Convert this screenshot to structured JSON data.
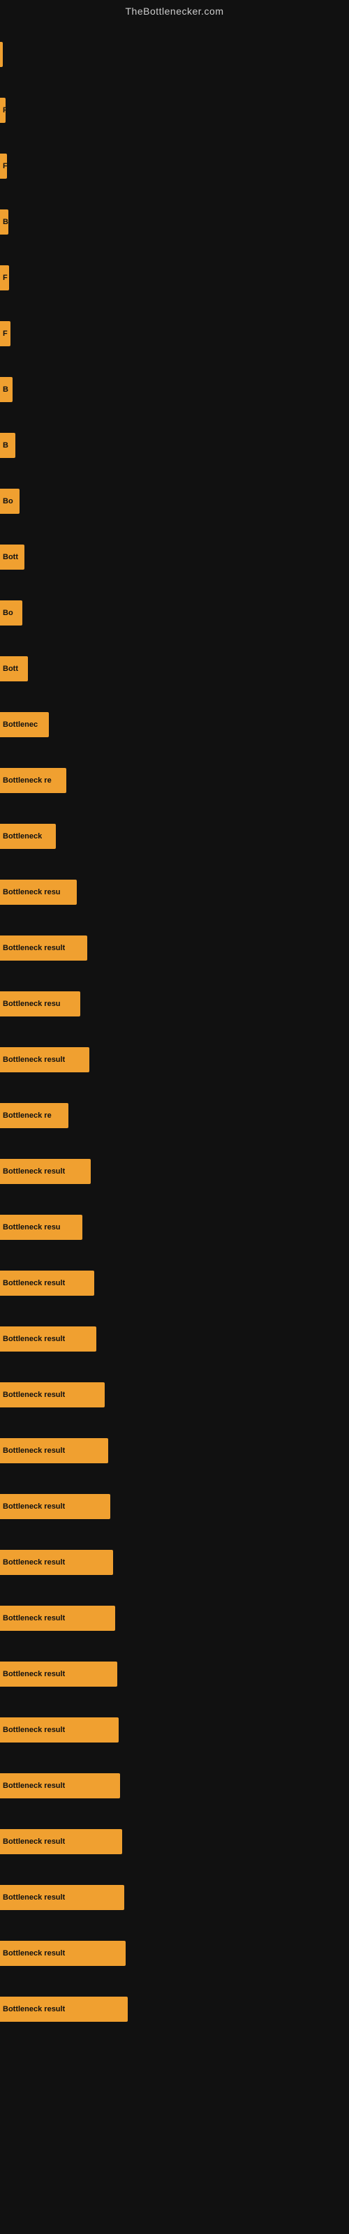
{
  "site_title": "TheBottlenecker.com",
  "bars": [
    {
      "label": "|",
      "width": 4
    },
    {
      "label": "F",
      "width": 8
    },
    {
      "label": "F",
      "width": 10
    },
    {
      "label": "B",
      "width": 12
    },
    {
      "label": "F",
      "width": 13
    },
    {
      "label": "F",
      "width": 15
    },
    {
      "label": "B",
      "width": 18
    },
    {
      "label": "B",
      "width": 22
    },
    {
      "label": "Bo",
      "width": 28
    },
    {
      "label": "Bott",
      "width": 35
    },
    {
      "label": "Bo",
      "width": 32
    },
    {
      "label": "Bott",
      "width": 40
    },
    {
      "label": "Bottlenec",
      "width": 70
    },
    {
      "label": "Bottleneck re",
      "width": 95
    },
    {
      "label": "Bottleneck",
      "width": 80
    },
    {
      "label": "Bottleneck resu",
      "width": 110
    },
    {
      "label": "Bottleneck result",
      "width": 125
    },
    {
      "label": "Bottleneck resu",
      "width": 115
    },
    {
      "label": "Bottleneck result",
      "width": 128
    },
    {
      "label": "Bottleneck re",
      "width": 98
    },
    {
      "label": "Bottleneck result",
      "width": 130
    },
    {
      "label": "Bottleneck resu",
      "width": 118
    },
    {
      "label": "Bottleneck result",
      "width": 135
    },
    {
      "label": "Bottleneck result",
      "width": 138
    },
    {
      "label": "Bottleneck result",
      "width": 150
    },
    {
      "label": "Bottleneck result",
      "width": 155
    },
    {
      "label": "Bottleneck result",
      "width": 158
    },
    {
      "label": "Bottleneck result",
      "width": 162
    },
    {
      "label": "Bottleneck result",
      "width": 165
    },
    {
      "label": "Bottleneck result",
      "width": 168
    },
    {
      "label": "Bottleneck result",
      "width": 170
    },
    {
      "label": "Bottleneck result",
      "width": 172
    },
    {
      "label": "Bottleneck result",
      "width": 175
    },
    {
      "label": "Bottleneck result",
      "width": 178
    },
    {
      "label": "Bottleneck result",
      "width": 180
    },
    {
      "label": "Bottleneck result",
      "width": 183
    }
  ]
}
